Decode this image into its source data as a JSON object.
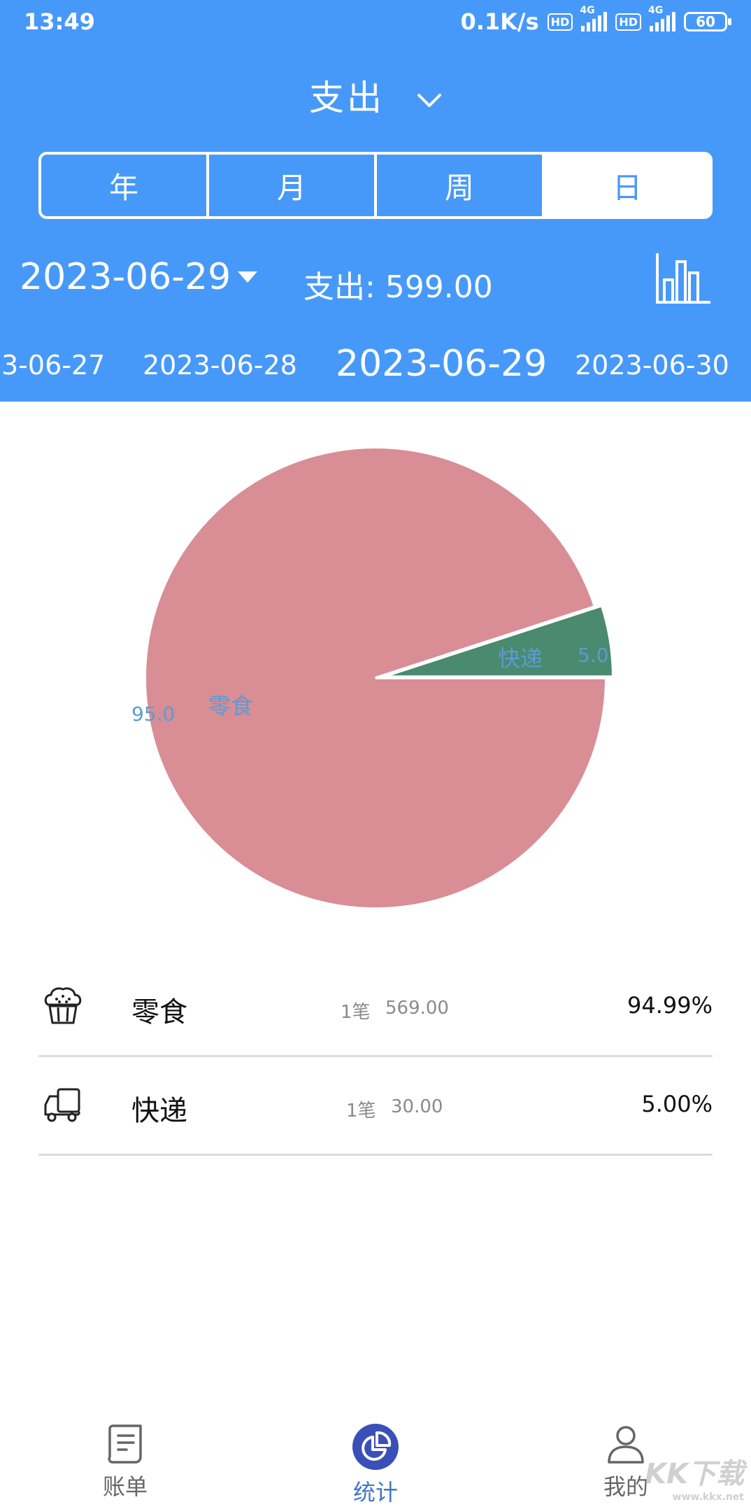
{
  "status_bar": {
    "time": "13:49",
    "speed": "0.1K/s",
    "hd": "HD",
    "network": "4G",
    "battery": "60"
  },
  "header": {
    "type_label": "支出",
    "tabs": [
      {
        "label": "年",
        "active": false
      },
      {
        "label": "月",
        "active": false
      },
      {
        "label": "周",
        "active": false
      },
      {
        "label": "日",
        "active": true
      }
    ],
    "current_date": "2023-06-29",
    "expense_total": "支出: 599.00",
    "accent_color": "#4799f9"
  },
  "date_strip": {
    "items": [
      {
        "label": "3-06-27",
        "selected": false
      },
      {
        "label": "2023-06-28",
        "selected": false
      },
      {
        "label": "2023-06-29",
        "selected": true
      },
      {
        "label": "2023-06-30",
        "selected": false
      }
    ]
  },
  "chart_data": {
    "type": "pie",
    "slices": [
      {
        "name": "零食",
        "value": 95.0,
        "value_label": "95.0",
        "color": "#d98d94"
      },
      {
        "name": "快递",
        "value": 5.0,
        "value_label": "5.0",
        "color": "#4a8a6e"
      }
    ],
    "label_color": "#5b9bd5"
  },
  "categories": [
    {
      "name": "零食",
      "count": "1笔",
      "amount": "569.00",
      "percent": "94.99%",
      "icon": "cake-icon"
    },
    {
      "name": "快递",
      "count": "1笔",
      "amount": "30.00",
      "percent": "5.00%",
      "icon": "truck-icon"
    }
  ],
  "bottom_nav": {
    "items": [
      {
        "label": "账单",
        "icon": "bill-icon",
        "active": false
      },
      {
        "label": "统计",
        "icon": "pie-chart-icon",
        "active": true
      },
      {
        "label": "我的",
        "icon": "profile-icon",
        "active": false
      }
    ]
  },
  "watermark": {
    "text": "KK下载",
    "sub": "www.kkx.net"
  }
}
